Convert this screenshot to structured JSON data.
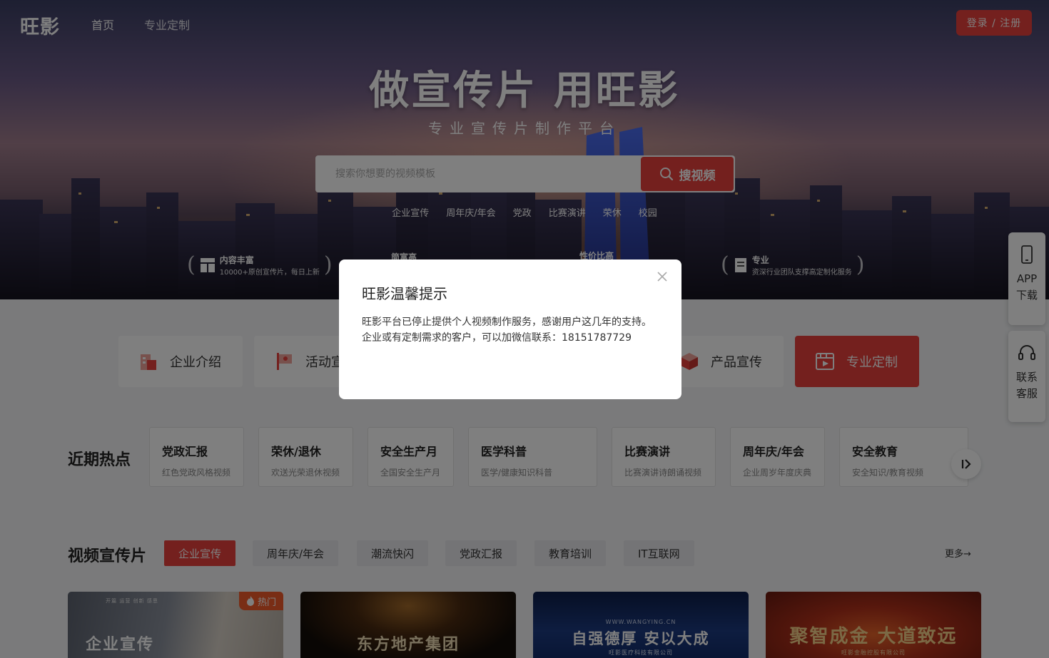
{
  "header": {
    "logo": "旺影",
    "nav": [
      "首页",
      "专业定制"
    ],
    "login_label": "登录 / 注册"
  },
  "hero": {
    "title": "做宣传片 用旺影",
    "subtitle": "专业宣传片制作平台",
    "search_placeholder": "搜索你想要的视频模板",
    "search_button": "搜视频",
    "hot_tags": [
      "企业宣传",
      "周年庆/年会",
      "党政",
      "比赛演讲",
      "荣休",
      "校园"
    ],
    "features": [
      {
        "title": "内容丰富",
        "desc": "10000+原创宣传片，每日上新"
      },
      {
        "title": "简富高",
        "desc": ""
      },
      {
        "title": "性价比高",
        "desc": ""
      },
      {
        "title": "专业",
        "desc": "资深行业团队支撑高定制化服务"
      }
    ]
  },
  "categories": [
    {
      "label": "企业介绍",
      "active": false
    },
    {
      "label": "活动宣",
      "active": false
    },
    {
      "label": "产品宣传",
      "active": false
    },
    {
      "label": "专业定制",
      "active": true
    }
  ],
  "hot_section": {
    "title": "近期热点",
    "items": [
      {
        "title": "党政汇报",
        "desc": "红色党政风格视频"
      },
      {
        "title": "荣休/退休",
        "desc": "欢送光荣退休视频"
      },
      {
        "title": "安全生产月",
        "desc": "全国安全生产月"
      },
      {
        "title": "医学科普",
        "desc": "医学/健康知识科普"
      },
      {
        "title": "比赛演讲",
        "desc": "比赛演讲诗朗诵视频"
      },
      {
        "title": "周年庆/年会",
        "desc": "企业周岁年度庆典"
      },
      {
        "title": "安全教育",
        "desc": "安全知识/教育视频"
      }
    ]
  },
  "video_section": {
    "title": "视频宣传片",
    "tabs": [
      "企业宣传",
      "周年庆/年会",
      "潮流快闪",
      "党政汇报",
      "教育培训",
      "IT互联网"
    ],
    "more": "更多",
    "cards": [
      {
        "caption": "企业宣传",
        "sub": "",
        "badge": "热门",
        "top_labels": "开篇 运营 创新 感恩"
      },
      {
        "caption": "东方地产集团",
        "sub": "",
        "badge": "",
        "top_labels": ""
      },
      {
        "caption": "自强德厚 安以大成",
        "sub": "旺影医疗科技有限公司",
        "badge": "",
        "top_labels": "WWW.WANGYING.CN"
      },
      {
        "caption": "聚智成金 大道致远",
        "sub": "旺影金融控股有限公司",
        "badge": "",
        "top_labels": ""
      }
    ]
  },
  "side": {
    "app_line1": "APP",
    "app_line2": "下载",
    "service_line1": "联系",
    "service_line2": "客服"
  },
  "modal": {
    "title": "旺影温馨提示",
    "line1": "旺影平台已停止提供个人视频制作服务，感谢用户这几年的支持。",
    "line2": "企业或有定制需求的客户，可以加微信联系：18151787729"
  },
  "colors": {
    "accent": "#e8413c",
    "hot_badge": "#f25b2a",
    "mask": "rgba(0,0,0,0.5)"
  }
}
